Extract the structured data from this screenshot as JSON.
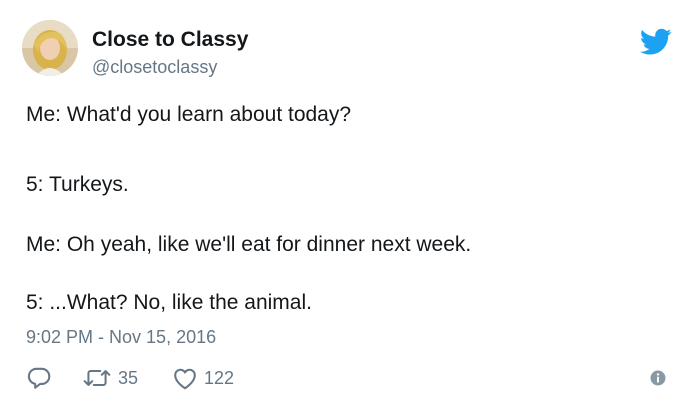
{
  "author": {
    "display_name": "Close to Classy",
    "handle": "@closetoclassy"
  },
  "tweet": {
    "lines": [
      "Me: What'd you learn about today?",
      "5: Turkeys.",
      "Me: Oh yeah, like we'll eat for dinner next week.",
      "5: ...What? No, like the animal."
    ],
    "timestamp": "9:02 PM - Nov 15, 2016"
  },
  "actions": {
    "retweet_count": "35",
    "like_count": "122"
  },
  "icons": {
    "reply": "reply-icon",
    "retweet": "retweet-icon",
    "like": "heart-icon",
    "info": "info-icon",
    "brand": "twitter-bird-icon"
  },
  "colors": {
    "brand": "#1da1f2",
    "secondary_text": "#657786",
    "primary_text": "#14171a"
  }
}
